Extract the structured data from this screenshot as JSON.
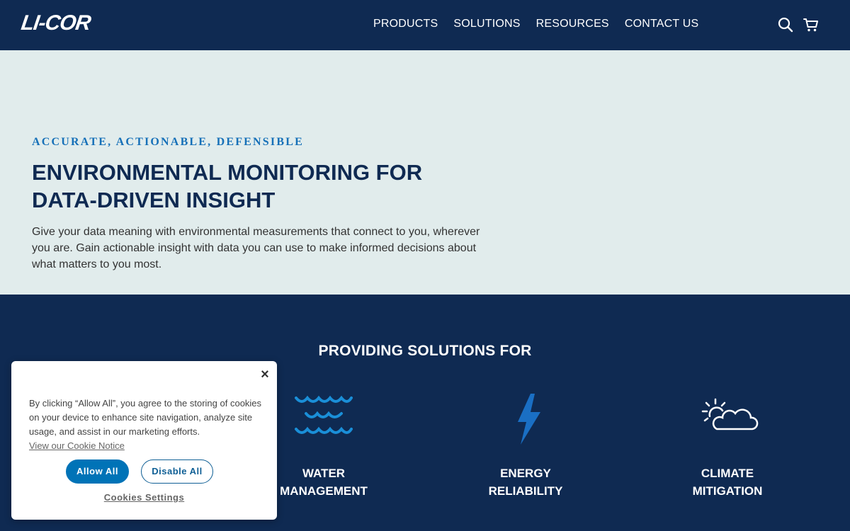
{
  "header": {
    "logo_text": "LI-COR",
    "nav": [
      "PRODUCTS",
      "SOLUTIONS",
      "RESOURCES",
      "CONTACT US"
    ]
  },
  "hero": {
    "eyebrow": "ACCURATE, ACTIONABLE, DEFENSIBLE",
    "title": "ENVIRONMENTAL MONITORING FOR DATA-DRIVEN INSIGHT",
    "body": "Give your data meaning with environmental measurements that connect to you, wherever you are. Gain actionable insight with data you can use to make informed decisions about what matters to you most."
  },
  "solutions": {
    "title": "PROVIDING SOLUTIONS FOR",
    "items": [
      {
        "label": "WATER\nMANAGEMENT",
        "icon": "water-waves-icon"
      },
      {
        "label": "ENERGY\nRELIABILITY",
        "icon": "lightning-bolt-icon"
      },
      {
        "label": "CLIMATE\nMITIGATION",
        "icon": "sun-cloud-icon"
      }
    ]
  },
  "cookie": {
    "close": "×",
    "text": "By clicking “Allow All”, you agree to the storing of cookies on your device to enhance site navigation, analyze site usage, and assist in our marketing efforts.",
    "link": "View our Cookie Notice",
    "allow": "Allow All",
    "disable": "Disable All",
    "settings": "Cookies Settings"
  },
  "colors": {
    "navy": "#0f2a52",
    "hero_bg": "#e1ecec",
    "accent_blue": "#1670b8",
    "icon_blue": "#1a8fd8"
  }
}
